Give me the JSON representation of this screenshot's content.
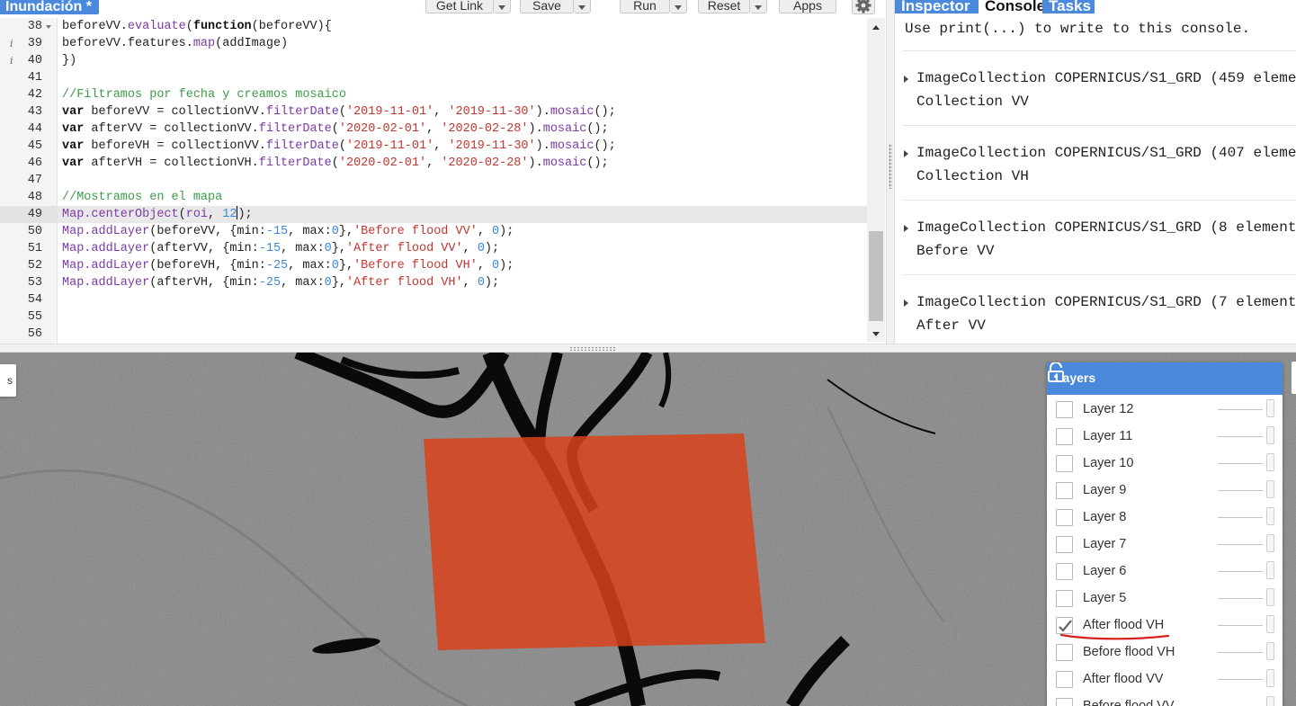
{
  "editor": {
    "title": "Inundación *",
    "toolbar": {
      "get_link": "Get Link",
      "save": "Save",
      "run": "Run",
      "reset": "Reset",
      "apps": "Apps"
    },
    "lines": [
      {
        "num": "38",
        "info": false,
        "fold": true,
        "highlight": false,
        "tokens": [
          [
            "p",
            "beforeVV."
          ],
          [
            "f",
            "evaluate"
          ],
          [
            "p",
            "("
          ],
          [
            "k",
            "function"
          ],
          [
            "p",
            "(beforeVV){"
          ]
        ]
      },
      {
        "num": "39",
        "info": true,
        "fold": false,
        "highlight": false,
        "tokens": [
          [
            "p",
            "beforeVV.features."
          ],
          [
            "f",
            "map"
          ],
          [
            "p",
            "(addImage)"
          ]
        ]
      },
      {
        "num": "40",
        "info": true,
        "fold": false,
        "highlight": false,
        "tokens": [
          [
            "p",
            "})"
          ]
        ]
      },
      {
        "num": "41",
        "info": false,
        "fold": false,
        "highlight": false,
        "tokens": []
      },
      {
        "num": "42",
        "info": false,
        "fold": false,
        "highlight": false,
        "tokens": [
          [
            "c",
            "//Filtramos por fecha y creamos mosaico"
          ]
        ]
      },
      {
        "num": "43",
        "info": false,
        "fold": false,
        "highlight": false,
        "tokens": [
          [
            "k",
            "var"
          ],
          [
            "p",
            " beforeVV = collectionVV."
          ],
          [
            "f",
            "filterDate"
          ],
          [
            "p",
            "("
          ],
          [
            "s",
            "'2019-11-01'"
          ],
          [
            "p",
            ", "
          ],
          [
            "s",
            "'2019-11-30'"
          ],
          [
            "p",
            ")."
          ],
          [
            "f",
            "mosaic"
          ],
          [
            "p",
            "();"
          ]
        ]
      },
      {
        "num": "44",
        "info": false,
        "fold": false,
        "highlight": false,
        "tokens": [
          [
            "k",
            "var"
          ],
          [
            "p",
            " afterVV = collectionVV."
          ],
          [
            "f",
            "filterDate"
          ],
          [
            "p",
            "("
          ],
          [
            "s",
            "'2020-02-01'"
          ],
          [
            "p",
            ", "
          ],
          [
            "s",
            "'2020-02-28'"
          ],
          [
            "p",
            ")."
          ],
          [
            "f",
            "mosaic"
          ],
          [
            "p",
            "();"
          ]
        ]
      },
      {
        "num": "45",
        "info": false,
        "fold": false,
        "highlight": false,
        "tokens": [
          [
            "k",
            "var"
          ],
          [
            "p",
            " beforeVH = collectionVV."
          ],
          [
            "f",
            "filterDate"
          ],
          [
            "p",
            "("
          ],
          [
            "s",
            "'2019-11-01'"
          ],
          [
            "p",
            ", "
          ],
          [
            "s",
            "'2019-11-30'"
          ],
          [
            "p",
            ")."
          ],
          [
            "f",
            "mosaic"
          ],
          [
            "p",
            "();"
          ]
        ]
      },
      {
        "num": "46",
        "info": false,
        "fold": false,
        "highlight": false,
        "tokens": [
          [
            "k",
            "var"
          ],
          [
            "p",
            " afterVH = collectionVH."
          ],
          [
            "f",
            "filterDate"
          ],
          [
            "p",
            "("
          ],
          [
            "s",
            "'2020-02-01'"
          ],
          [
            "p",
            ", "
          ],
          [
            "s",
            "'2020-02-28'"
          ],
          [
            "p",
            ")."
          ],
          [
            "f",
            "mosaic"
          ],
          [
            "p",
            "();"
          ]
        ]
      },
      {
        "num": "47",
        "info": false,
        "fold": false,
        "highlight": false,
        "tokens": []
      },
      {
        "num": "48",
        "info": false,
        "fold": false,
        "highlight": false,
        "tokens": [
          [
            "c",
            "//Mostramos en el mapa"
          ]
        ]
      },
      {
        "num": "49",
        "info": false,
        "fold": false,
        "highlight": true,
        "tokens": [
          [
            "f",
            "Map.centerObject"
          ],
          [
            "p",
            "("
          ],
          [
            "f",
            "roi"
          ],
          [
            "p",
            ", "
          ],
          [
            "n",
            "12"
          ],
          [
            "cur",
            ""
          ],
          [
            "p",
            ");"
          ]
        ]
      },
      {
        "num": "50",
        "info": false,
        "fold": false,
        "highlight": false,
        "tokens": [
          [
            "f",
            "Map.addLayer"
          ],
          [
            "p",
            "(beforeVV, {min:"
          ],
          [
            "n",
            "-15"
          ],
          [
            "p",
            ", max:"
          ],
          [
            "n",
            "0"
          ],
          [
            "p",
            "},"
          ],
          [
            "s",
            "'Before flood VV'"
          ],
          [
            "p",
            ", "
          ],
          [
            "n",
            "0"
          ],
          [
            "p",
            ");"
          ]
        ]
      },
      {
        "num": "51",
        "info": false,
        "fold": false,
        "highlight": false,
        "tokens": [
          [
            "f",
            "Map.addLayer"
          ],
          [
            "p",
            "(afterVV, {min:"
          ],
          [
            "n",
            "-15"
          ],
          [
            "p",
            ", max:"
          ],
          [
            "n",
            "0"
          ],
          [
            "p",
            "},"
          ],
          [
            "s",
            "'After flood VV'"
          ],
          [
            "p",
            ", "
          ],
          [
            "n",
            "0"
          ],
          [
            "p",
            ");"
          ]
        ]
      },
      {
        "num": "52",
        "info": false,
        "fold": false,
        "highlight": false,
        "tokens": [
          [
            "f",
            "Map.addLayer"
          ],
          [
            "p",
            "(beforeVH, {min:"
          ],
          [
            "n",
            "-25"
          ],
          [
            "p",
            ", max:"
          ],
          [
            "n",
            "0"
          ],
          [
            "p",
            "},"
          ],
          [
            "s",
            "'Before flood VH'"
          ],
          [
            "p",
            ", "
          ],
          [
            "n",
            "0"
          ],
          [
            "p",
            ");"
          ]
        ]
      },
      {
        "num": "53",
        "info": false,
        "fold": false,
        "highlight": false,
        "tokens": [
          [
            "f",
            "Map.addLayer"
          ],
          [
            "p",
            "(afterVH, {min:"
          ],
          [
            "n",
            "-25"
          ],
          [
            "p",
            ", max:"
          ],
          [
            "n",
            "0"
          ],
          [
            "p",
            "},"
          ],
          [
            "s",
            "'After flood VH'"
          ],
          [
            "p",
            ", "
          ],
          [
            "n",
            "0"
          ],
          [
            "p",
            ");"
          ]
        ]
      },
      {
        "num": "54",
        "info": false,
        "fold": false,
        "highlight": false,
        "tokens": []
      },
      {
        "num": "55",
        "info": false,
        "fold": false,
        "highlight": false,
        "tokens": []
      },
      {
        "num": "56",
        "info": false,
        "fold": false,
        "highlight": false,
        "tokens": []
      }
    ]
  },
  "console": {
    "tabs": {
      "inspector": "Inspector",
      "console": "Console",
      "tasks": "Tasks"
    },
    "hint": "Use print(...) to write to this console.",
    "entries": [
      {
        "line1": "ImageCollection COPERNICUS/S1_GRD (459 eleme",
        "line2": "Collection VV"
      },
      {
        "line1": "ImageCollection COPERNICUS/S1_GRD (407 eleme",
        "line2": "Collection VH"
      },
      {
        "line1": "ImageCollection COPERNICUS/S1_GRD (8 element",
        "line2": "Before VV"
      },
      {
        "line1": "ImageCollection COPERNICUS/S1_GRD (7 element",
        "line2": "After VV"
      }
    ]
  },
  "map": {
    "left_control_label": "s",
    "overlay_color": "#d9421b",
    "layers_title": "Layers",
    "layers": [
      {
        "label": "Layer 12",
        "checked": false
      },
      {
        "label": "Layer 11",
        "checked": false
      },
      {
        "label": "Layer 10",
        "checked": false
      },
      {
        "label": "Layer 9",
        "checked": false
      },
      {
        "label": "Layer 8",
        "checked": false
      },
      {
        "label": "Layer 7",
        "checked": false
      },
      {
        "label": "Layer 6",
        "checked": false
      },
      {
        "label": "Layer 5",
        "checked": false
      },
      {
        "label": "After flood VH",
        "checked": true
      },
      {
        "label": "Before flood VH",
        "checked": false
      },
      {
        "label": "After flood VV",
        "checked": false
      },
      {
        "label": "Before flood VV",
        "checked": false
      }
    ]
  },
  "colors": {
    "accent_blue": "#4a89dc",
    "annotation_red": "#d62020"
  }
}
